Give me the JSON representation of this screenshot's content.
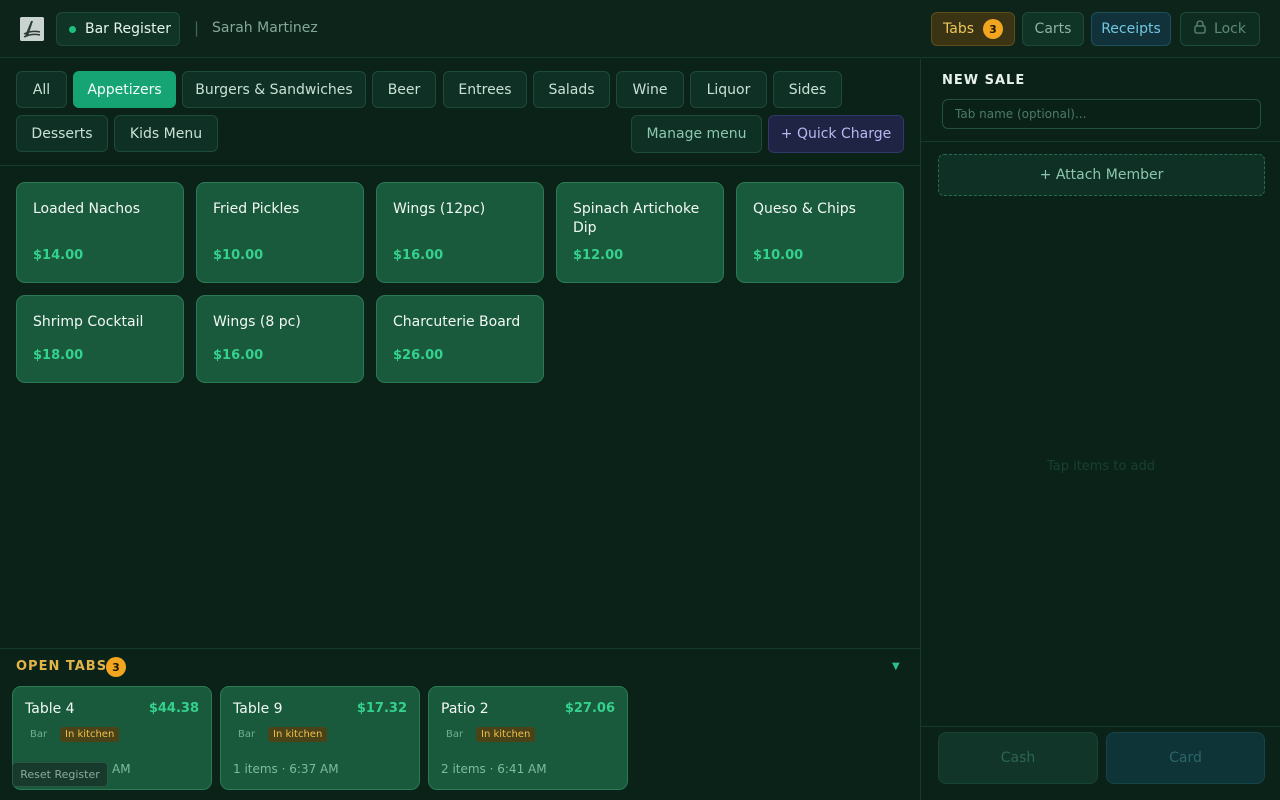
{
  "header": {
    "register_label": "Bar Register",
    "separator": "|",
    "user_name": "Sarah Martinez",
    "tabs_label": "Tabs",
    "tabs_count": "3",
    "carts_label": "Carts",
    "receipts_label": "Receipts",
    "lock_label": "Lock"
  },
  "categories": [
    {
      "label": "All",
      "active": false
    },
    {
      "label": "Appetizers",
      "active": true
    },
    {
      "label": "Burgers & Sandwiches",
      "active": false
    },
    {
      "label": "Beer",
      "active": false
    },
    {
      "label": "Entrees",
      "active": false
    },
    {
      "label": "Salads",
      "active": false
    },
    {
      "label": "Wine",
      "active": false
    },
    {
      "label": "Liquor",
      "active": false
    },
    {
      "label": "Sides",
      "active": false
    },
    {
      "label": "Desserts",
      "active": false
    },
    {
      "label": "Kids Menu",
      "active": false
    }
  ],
  "actions": {
    "manage_menu": "Manage menu",
    "quick_charge": "+ Quick Charge"
  },
  "items": [
    {
      "name": "Loaded Nachos",
      "price": "$14.00"
    },
    {
      "name": "Fried Pickles",
      "price": "$10.00"
    },
    {
      "name": "Wings (12pc)",
      "price": "$16.00"
    },
    {
      "name": "Spinach Artichoke Dip",
      "price": "$12.00"
    },
    {
      "name": "Queso & Chips",
      "price": "$10.00"
    },
    {
      "name": "Shrimp Cocktail",
      "price": "$18.00"
    },
    {
      "name": "Wings (8 pc)",
      "price": "$16.00"
    },
    {
      "name": "Charcuterie Board",
      "price": "$26.00"
    }
  ],
  "open_tabs": {
    "title": "OPEN TABS",
    "count": "3",
    "toggle": "▼",
    "tabs": [
      {
        "name": "Table 4",
        "amount": "$44.38",
        "location": "Bar",
        "status": "In kitchen",
        "meta": "3 items · 6:32 AM"
      },
      {
        "name": "Table 9",
        "amount": "$17.32",
        "location": "Bar",
        "status": "In kitchen",
        "meta": "1 items · 6:37 AM"
      },
      {
        "name": "Patio 2",
        "amount": "$27.06",
        "location": "Bar",
        "status": "In kitchen",
        "meta": "2 items · 6:41 AM"
      }
    ]
  },
  "reset_label": "Reset Register",
  "sale": {
    "title": "NEW SALE",
    "tab_name_placeholder": "Tab name (optional)...",
    "attach_member": "+ Attach Member",
    "empty_hint": "Tap items to add",
    "cash_label": "Cash",
    "card_label": "Card"
  },
  "colors": {
    "accent": "#17a474",
    "background": "#0b2219",
    "tile": "#1a5a3c",
    "price": "#34d18e",
    "warning": "#f2a620"
  }
}
